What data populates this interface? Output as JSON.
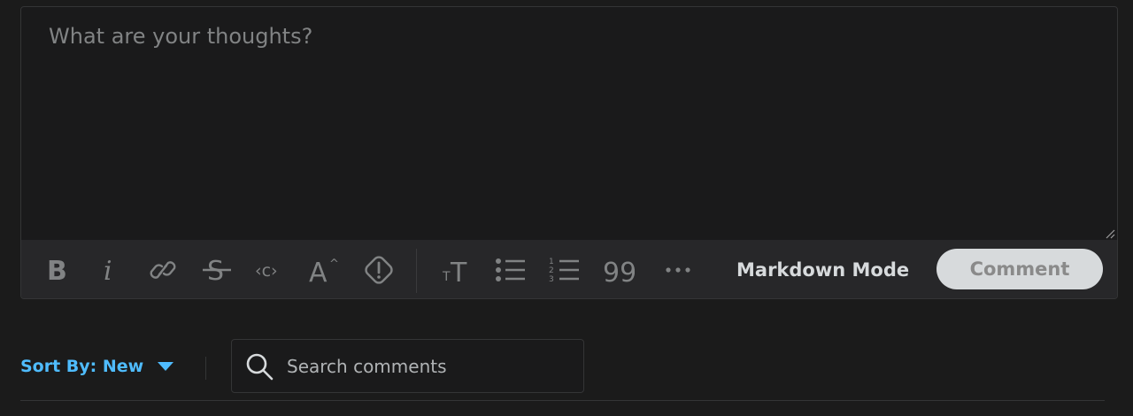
{
  "editor": {
    "placeholder": "What are your thoughts?",
    "toolbar": {
      "tools": [
        "bold-icon",
        "italic-icon",
        "link-icon",
        "strikethrough-icon",
        "inline-code-icon",
        "superscript-icon",
        "spoiler-icon",
        "heading-icon",
        "bulleted-list-icon",
        "numbered-list-icon",
        "quote-icon",
        "more-icon"
      ],
      "markdown_mode_label": "Markdown Mode",
      "comment_label": "Comment"
    }
  },
  "sort": {
    "label": "Sort By: New",
    "icon": "caret-down-icon"
  },
  "search": {
    "placeholder": "Search comments",
    "icon": "search-icon"
  },
  "colors": {
    "accent": "#4fbcff",
    "background": "#1b1b1b",
    "toolbar": "#272729",
    "button": "#d7dadc"
  }
}
